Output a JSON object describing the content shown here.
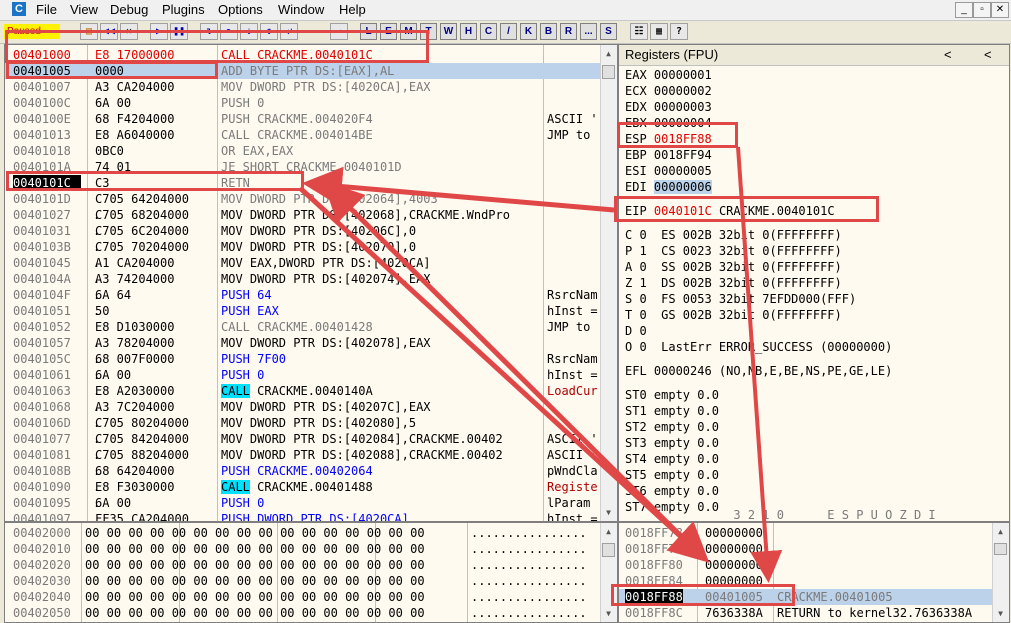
{
  "menubar": {
    "app_icon": "C",
    "items": [
      "File",
      "View",
      "Debug",
      "Plugins",
      "Options",
      "Window",
      "Help"
    ],
    "window_buttons": [
      "_",
      "▫",
      "✕"
    ]
  },
  "toolbar": {
    "status": "Paused",
    "letters": [
      "L",
      "E",
      "M",
      "T",
      "W",
      "H",
      "C",
      "/",
      "K",
      "B",
      "R",
      "...",
      "S"
    ]
  },
  "cpu": {
    "rows": [
      {
        "addr": "00401000",
        "mark": "",
        "hex": "E8 17000000",
        "dis": "CALL CRACKME.0040101C",
        "cmt": ""
      },
      {
        "addr": "00401005",
        "mark": "",
        "hex": "0000",
        "dis": "ADD BYTE PTR DS:[EAX],AL",
        "cmt": ""
      },
      {
        "addr": "00401007",
        "mark": "",
        "hex": "A3 CA204000",
        "dis": "MOV DWORD PTR DS:[4020CA],EAX",
        "cmt": ""
      },
      {
        "addr": "0040100C",
        "mark": "",
        "hex": "6A 00",
        "dis": "PUSH 0",
        "cmt": ""
      },
      {
        "addr": "0040100E",
        "mark": "",
        "hex": "68 F4204000",
        "dis": "PUSH CRACKME.004020F4",
        "cmt": "ASCII '"
      },
      {
        "addr": "00401013",
        "mark": "",
        "hex": "E8 A6040000",
        "dis": "CALL CRACKME.004014BE",
        "cmt": "JMP to"
      },
      {
        "addr": "00401018",
        "mark": "",
        "hex": "0BC0",
        "dis": "OR EAX,EAX",
        "cmt": ""
      },
      {
        "addr": "0040101A",
        "mark": "",
        "hex": "74 01",
        "dis": "JE SHORT CRACKME.0040101D",
        "cmt": ""
      },
      {
        "addr": "0040101C",
        "mark": "",
        "hex": "C3",
        "dis": "RETN",
        "cmt": ""
      },
      {
        "addr": "0040101D",
        "mark": "",
        "hex": "C705 64204000",
        "dis": "MOV DWORD PTR DS:[402064],4003",
        "cmt": ""
      },
      {
        "addr": "00401027",
        "mark": ".",
        "hex": "C705 68204000",
        "dis": "MOV DWORD PTR DS:[402068],CRACKME.WndPro",
        "cmt": ""
      },
      {
        "addr": "00401031",
        "mark": ".",
        "hex": "C705 6C204000",
        "dis": "MOV DWORD PTR DS:[40206C],0",
        "cmt": ""
      },
      {
        "addr": "0040103B",
        "mark": ".",
        "hex": "C705 70204000",
        "dis": "MOV DWORD PTR DS:[402070],0",
        "cmt": ""
      },
      {
        "addr": "00401045",
        "mark": ".",
        "hex": "A1 CA204000",
        "dis": "MOV EAX,DWORD PTR DS:[4020CA]",
        "cmt": ""
      },
      {
        "addr": "0040104A",
        "mark": ".",
        "hex": "A3 74204000",
        "dis": "MOV DWORD PTR DS:[402074],EAX",
        "cmt": ""
      },
      {
        "addr": "0040104F",
        "mark": ".",
        "hex": "6A 64",
        "dis": "PUSH 64",
        "cmt": "RsrcNam"
      },
      {
        "addr": "00401051",
        "mark": ".",
        "hex": "50",
        "dis": "PUSH EAX",
        "cmt": "hInst ="
      },
      {
        "addr": "00401052",
        "mark": "",
        "hex": "E8 D1030000",
        "dis": "CALL CRACKME.00401428",
        "cmt": "JMP to"
      },
      {
        "addr": "00401057",
        "mark": ".",
        "hex": "A3 78204000",
        "dis": "MOV DWORD PTR DS:[402078],EAX",
        "cmt": ""
      },
      {
        "addr": "0040105C",
        "mark": ".",
        "hex": "68 007F0000",
        "dis": "PUSH 7F00",
        "cmt": "RsrcNam"
      },
      {
        "addr": "00401061",
        "mark": ".",
        "hex": "6A 00",
        "dis": "PUSH 0",
        "cmt": "hInst ="
      },
      {
        "addr": "00401063",
        "mark": ".",
        "hex": "E8 A2030000",
        "dis": "CALL CRACKME.0040140A",
        "cmt": "LoadCur"
      },
      {
        "addr": "00401068",
        "mark": ".",
        "hex": "A3 7C204000",
        "dis": "MOV DWORD PTR DS:[40207C],EAX",
        "cmt": ""
      },
      {
        "addr": "0040106D",
        "mark": ".",
        "hex": "C705 80204000",
        "dis": "MOV DWORD PTR DS:[402080],5",
        "cmt": ""
      },
      {
        "addr": "00401077",
        "mark": ".",
        "hex": "C705 84204000",
        "dis": "MOV DWORD PTR DS:[402084],CRACKME.00402",
        "cmt": "ASCII '"
      },
      {
        "addr": "00401081",
        "mark": ".",
        "hex": "C705 88204000",
        "dis": "MOV DWORD PTR DS:[402088],CRACKME.00402",
        "cmt": "ASCII '"
      },
      {
        "addr": "0040108B",
        "mark": ".",
        "hex": "68 64204000",
        "dis": "PUSH CRACKME.00402064",
        "cmt": "pWndCla"
      },
      {
        "addr": "00401090",
        "mark": ".",
        "hex": "E8 F3030000",
        "dis": "CALL CRACKME.00401488",
        "cmt": "Registe"
      },
      {
        "addr": "00401095",
        "mark": ".",
        "hex": "6A 00",
        "dis": "PUSH 0",
        "cmt": "lParam"
      },
      {
        "addr": "00401097",
        "mark": "",
        "hex": "FF35 CA204000",
        "dis": "PUSH DWORD PTR DS:[4020CA]",
        "cmt": "hInst ="
      }
    ]
  },
  "registers": {
    "title": "Registers (FPU)",
    "nav_left": "<",
    "nav_right": "<",
    "gpr": [
      {
        "name": "EAX",
        "val": "00000001",
        "extra": ""
      },
      {
        "name": "ECX",
        "val": "00000002",
        "extra": ""
      },
      {
        "name": "EDX",
        "val": "00000003",
        "extra": ""
      },
      {
        "name": "EBX",
        "val": "00000004",
        "extra": ""
      },
      {
        "name": "ESP",
        "val": "0018FF88",
        "extra": ""
      },
      {
        "name": "EBP",
        "val": "0018FF94",
        "extra": ""
      },
      {
        "name": "ESI",
        "val": "00000005",
        "extra": ""
      },
      {
        "name": "EDI",
        "val": "00000006",
        "extra": ""
      }
    ],
    "eip": {
      "name": "EIP",
      "val": "0040101C",
      "extra": "CRACKME.0040101C"
    },
    "flags": [
      "C 0  ES 002B 32bit 0(FFFFFFFF)",
      "P 1  CS 0023 32bit 0(FFFFFFFF)",
      "A 0  SS 002B 32bit 0(FFFFFFFF)",
      "Z 1  DS 002B 32bit 0(FFFFFFFF)",
      "S 0  FS 0053 32bit 7EFDD000(FFF)",
      "T 0  GS 002B 32bit 0(FFFFFFFF)",
      "D 0",
      "O 0  LastErr ERROR_SUCCESS (00000000)"
    ],
    "efl": "EFL 00000246 (NO,NB,E,BE,NS,PE,GE,LE)",
    "fpu": [
      "ST0 empty 0.0",
      "ST1 empty 0.0",
      "ST2 empty 0.0",
      "ST3 empty 0.0",
      "ST4 empty 0.0",
      "ST5 empty 0.0",
      "ST6 empty 0.0",
      "ST7 empty 0.0"
    ],
    "fpu_footer": "               3 2 1 0      E S P U O Z D I"
  },
  "dump": {
    "rows": [
      {
        "addr": "00402000",
        "bytes": "00 00 00 00 00 00 00 00 00 00 00 00 00 00 00 00",
        "ascii": "................"
      },
      {
        "addr": "00402010",
        "bytes": "00 00 00 00 00 00 00 00 00 00 00 00 00 00 00 00",
        "ascii": "................"
      },
      {
        "addr": "00402020",
        "bytes": "00 00 00 00 00 00 00 00 00 00 00 00 00 00 00 00",
        "ascii": "................"
      },
      {
        "addr": "00402030",
        "bytes": "00 00 00 00 00 00 00 00 00 00 00 00 00 00 00 00",
        "ascii": "................"
      },
      {
        "addr": "00402040",
        "bytes": "00 00 00 00 00 00 00 00 00 00 00 00 00 00 00 00",
        "ascii": "................"
      },
      {
        "addr": "00402050",
        "bytes": "00 00 00 00 00 00 00 00 00 00 00 00 00 00 00 00",
        "ascii": "................"
      }
    ]
  },
  "stack": {
    "rows": [
      {
        "addr": "0018FF78",
        "val": "00000000",
        "cmt": ""
      },
      {
        "addr": "0018FF7C",
        "val": "00000000",
        "cmt": ""
      },
      {
        "addr": "0018FF80",
        "val": "00000000",
        "cmt": ""
      },
      {
        "addr": "0018FF84",
        "val": "00000000",
        "cmt": ""
      },
      {
        "addr": "0018FF88",
        "val": "00401005",
        "cmt": "CRACKME.00401005"
      },
      {
        "addr": "0018FF8C",
        "val": "7636338A",
        "cmt": "RETURN to kernel32.7636338A"
      }
    ]
  },
  "colors": {
    "annotation": "#e04848",
    "selection": "#bcd2ea",
    "call_highlight": "#00e0ff",
    "status_bg": "#fff200"
  }
}
